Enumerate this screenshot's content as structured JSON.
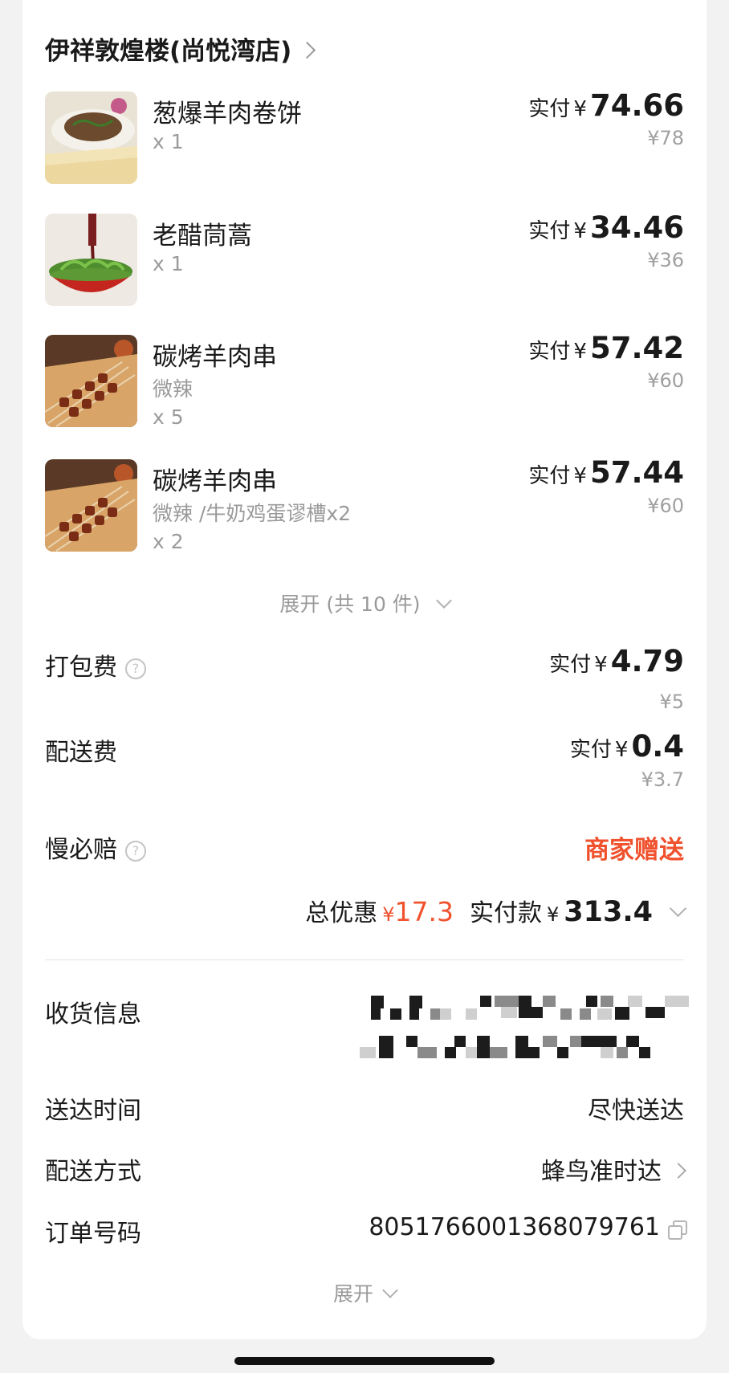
{
  "store": {
    "name": "伊祥敦煌楼(尚悦湾店)"
  },
  "items": [
    {
      "name": "葱爆羊肉卷饼",
      "spec": "",
      "qty": "x 1",
      "pay_label": "实付",
      "currency": "¥",
      "pay_amount": "74.66",
      "original": "¥78",
      "thumb_icon": "lamb-wrap-dish-image"
    },
    {
      "name": "老醋茼蒿",
      "spec": "",
      "qty": "x 1",
      "pay_label": "实付",
      "currency": "¥",
      "pay_amount": "34.46",
      "original": "¥36",
      "thumb_icon": "vinegar-greens-dish-image"
    },
    {
      "name": "碳烤羊肉串",
      "spec": "微辣",
      "qty": "x 5",
      "pay_label": "实付",
      "currency": "¥",
      "pay_amount": "57.42",
      "original": "¥60",
      "thumb_icon": "lamb-skewers-dish-image"
    },
    {
      "name": "碳烤羊肉串",
      "spec": "微辣 /牛奶鸡蛋谬槽x2",
      "qty": "x 2",
      "pay_label": "实付",
      "currency": "¥",
      "pay_amount": "57.44",
      "original": "¥60",
      "thumb_icon": "lamb-skewers-dish-image"
    }
  ],
  "expand_items": {
    "label": "展开 (共 10 件)"
  },
  "fees": {
    "packing": {
      "label": "打包费",
      "pay_label": "实付",
      "currency": "¥",
      "amount": "4.79",
      "original": "¥5"
    },
    "delivery": {
      "label": "配送费",
      "pay_label": "实付",
      "currency": "¥",
      "amount": "0.4",
      "original": "¥3.7"
    },
    "late_comp": {
      "label": "慢必赔",
      "value": "商家赠送"
    }
  },
  "totals": {
    "discount_label": "总优惠",
    "discount_currency": "¥",
    "discount_amount": "17.3",
    "paid_label": "实付款",
    "paid_currency": "¥",
    "paid_amount": "313.4"
  },
  "info": {
    "address_label": "收货信息",
    "delivery_time_label": "送达时间",
    "delivery_time_value": "尽快送达",
    "delivery_method_label": "配送方式",
    "delivery_method_value": "蜂鸟准时达",
    "order_no_label": "订单号码",
    "order_no_value": "8051766001368079761"
  },
  "expand_more": {
    "label": "展开"
  },
  "colors": {
    "accent_red": "#f0522e",
    "text": "#1a1a1a",
    "muted": "#9a9a9a",
    "background": "#f2f2f2"
  }
}
